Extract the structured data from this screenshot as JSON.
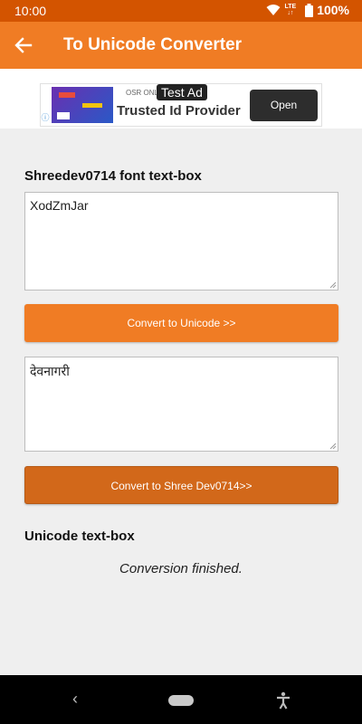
{
  "status_bar": {
    "time": "10:00",
    "network": "LTE",
    "battery": "100%"
  },
  "app_bar": {
    "title": "To Unicode Converter"
  },
  "ad": {
    "label": "Test Ad",
    "small_text": "OSR ONLI",
    "headline": "Trusted Id Provider",
    "open_label": "Open"
  },
  "input_section": {
    "label": "Shreedev0714 font text-box",
    "value": "XodZmJar"
  },
  "convert_unicode_button": "Convert to Unicode >>",
  "unicode_box": {
    "value": "देवनागरी"
  },
  "convert_shree_button": "Convert to Shree Dev0714>>",
  "unicode_section": {
    "label": "Unicode text-box"
  },
  "status_message": "Conversion finished.",
  "colors": {
    "status_bar": "#d35400",
    "app_bar": "#f07c24",
    "button": "#f07c24",
    "button_pressed": "#d2681a"
  }
}
